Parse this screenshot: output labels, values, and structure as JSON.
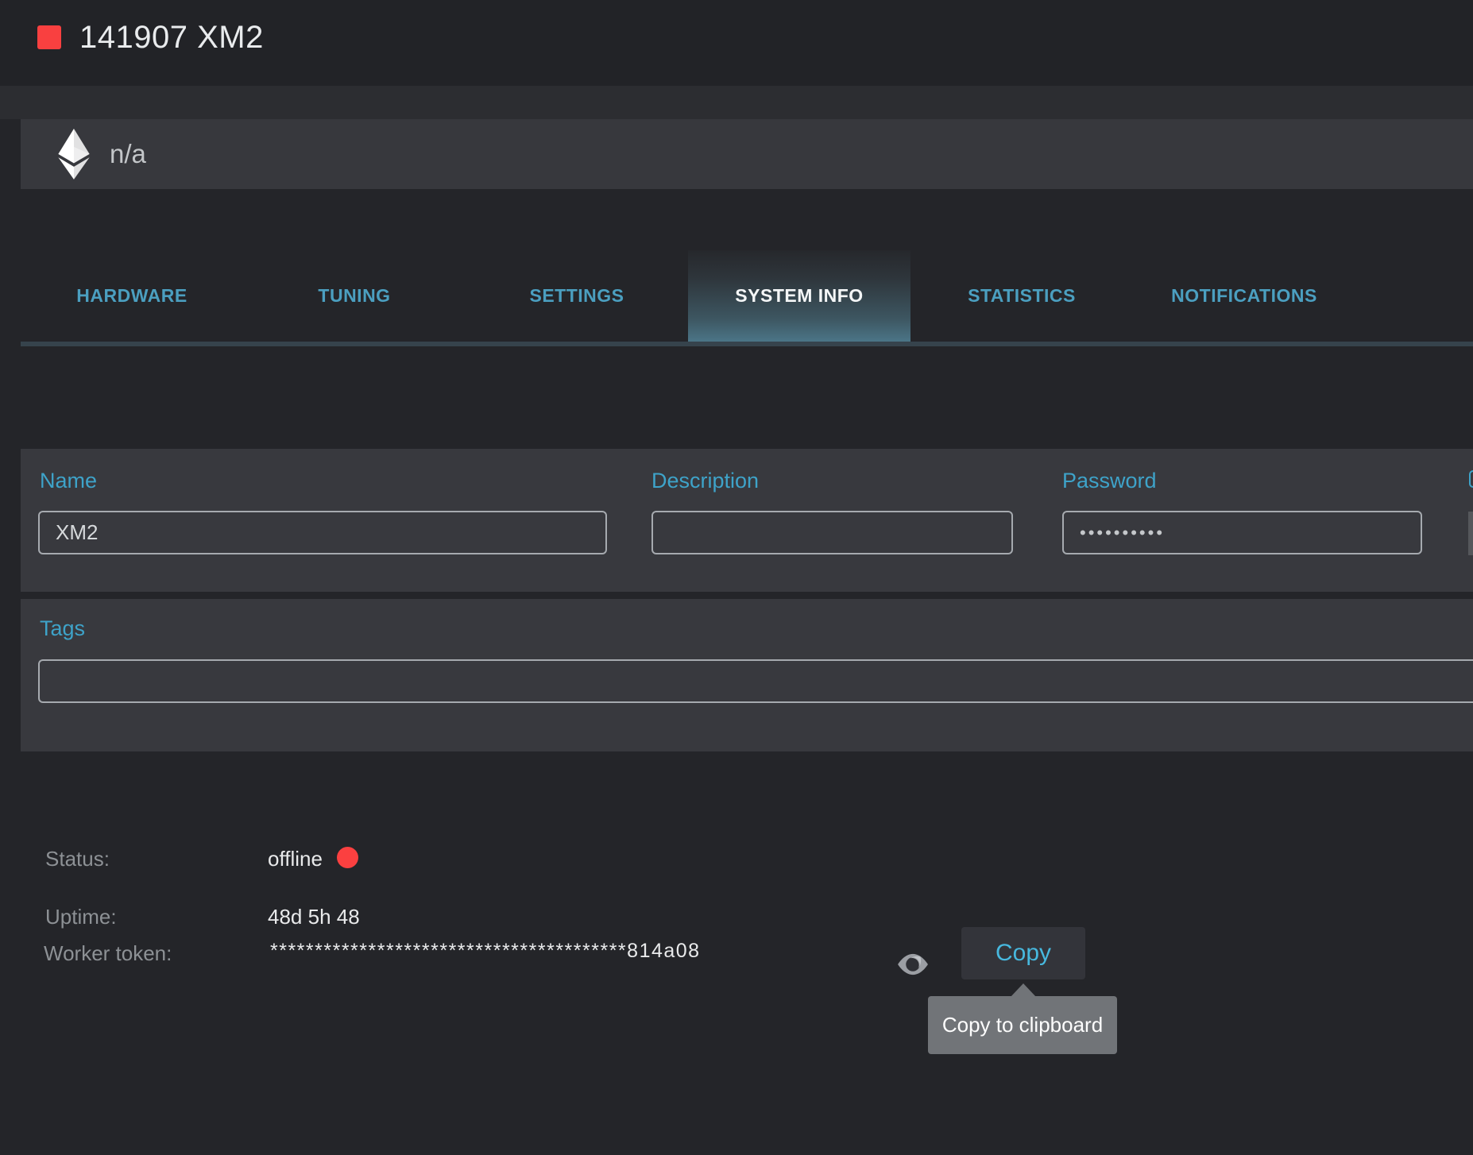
{
  "header": {
    "title": "141907 XM2"
  },
  "coin_bar": {
    "icon": "ethereum",
    "value": "n/a"
  },
  "tabs": {
    "items": [
      {
        "label": "HARDWARE",
        "active": false
      },
      {
        "label": "TUNING",
        "active": false
      },
      {
        "label": "SETTINGS",
        "active": false
      },
      {
        "label": "SYSTEM INFO",
        "active": true
      },
      {
        "label": "STATISTICS",
        "active": false
      },
      {
        "label": "NOTIFICATIONS",
        "active": false
      }
    ]
  },
  "form": {
    "name": {
      "label": "Name",
      "value": "XM2"
    },
    "description": {
      "label": "Description",
      "value": ""
    },
    "password": {
      "label": "Password",
      "value": "••••••••••"
    },
    "tags": {
      "label": "Tags",
      "value": ""
    }
  },
  "info": {
    "status": {
      "label": "Status:",
      "value": "offline",
      "indicator_color": "#fb4040"
    },
    "uptime": {
      "label": "Uptime:",
      "value": "48d 5h 48"
    },
    "worker_token": {
      "label": "Worker token:",
      "value": "****************************************814a08"
    },
    "copy_button_label": "Copy",
    "tooltip_text": "Copy to clipboard"
  },
  "colors": {
    "page_bg": "#242529",
    "panel_bg": "#38393e",
    "accent_cyan": "#3ea3c9",
    "tab_teal": "#4b9fc0",
    "status_red": "#fb4040"
  }
}
